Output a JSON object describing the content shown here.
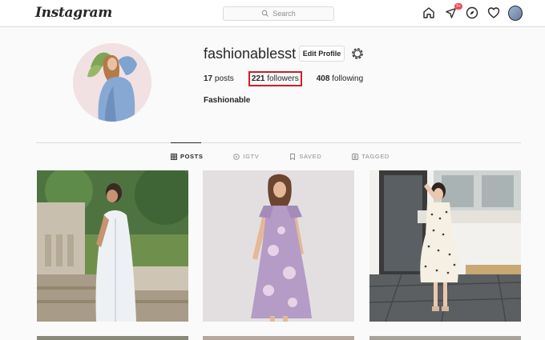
{
  "nav": {
    "logo": "Instagram",
    "search_placeholder": "Search",
    "activity_badge": "9+",
    "icons": [
      "home-icon",
      "direct-icon",
      "explore-icon",
      "heart-icon",
      "avatar"
    ]
  },
  "profile": {
    "username": "fashionablesst",
    "edit_button": "Edit Profile",
    "stats": {
      "posts_count": "17",
      "posts_label": "posts",
      "followers_count": "221",
      "followers_label": "followers",
      "following_count": "408",
      "following_label": "following"
    },
    "bio_name": "Fashionable"
  },
  "tabs": [
    {
      "label": "POSTS",
      "active": true
    },
    {
      "label": "IGTV",
      "active": false
    },
    {
      "label": "SAVED",
      "active": false
    },
    {
      "label": "TAGGED",
      "active": false
    }
  ],
  "colors": {
    "highlight_border": "#cc1f2a",
    "badge": "#ed4956",
    "text": "#262626",
    "muted": "#8e8e8e"
  }
}
